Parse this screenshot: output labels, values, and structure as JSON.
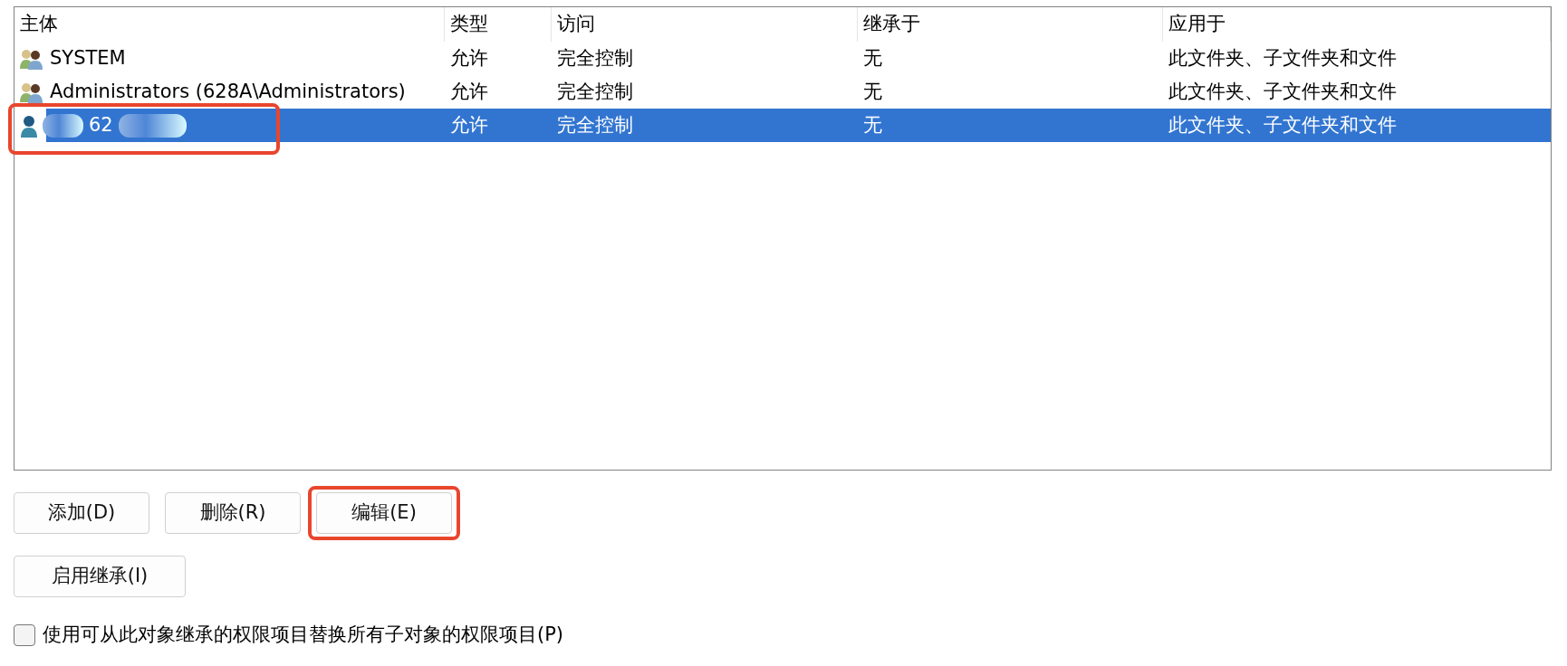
{
  "table": {
    "columns": [
      "主体",
      "类型",
      "访问",
      "继承于",
      "应用于"
    ],
    "rows": [
      {
        "kind": "group",
        "principal": "SYSTEM",
        "type": "允许",
        "access": "完全控制",
        "inherited_from": "无",
        "applies_to": "此文件夹、子文件夹和文件",
        "selected": false,
        "redacted": false,
        "highlighted": false
      },
      {
        "kind": "group",
        "principal": "Administrators (628A\\Administrators)",
        "type": "允许",
        "access": "完全控制",
        "inherited_from": "无",
        "applies_to": "此文件夹、子文件夹和文件",
        "selected": false,
        "redacted": false,
        "highlighted": false
      },
      {
        "kind": "user",
        "principal": "62",
        "type": "允许",
        "access": "完全控制",
        "inherited_from": "无",
        "applies_to": "此文件夹、子文件夹和文件",
        "selected": true,
        "redacted": true,
        "highlighted": true
      }
    ]
  },
  "buttons": [
    {
      "label": "添加(D)",
      "highlighted": false
    },
    {
      "label": "删除(R)",
      "highlighted": false
    },
    {
      "label": "编辑(E)",
      "highlighted": true
    }
  ],
  "inherit_button": {
    "label": "启用继承(I)"
  },
  "replace_checkbox": {
    "label": "使用可从此对象继承的权限项目替换所有子对象的权限项目(P)",
    "checked": false
  }
}
